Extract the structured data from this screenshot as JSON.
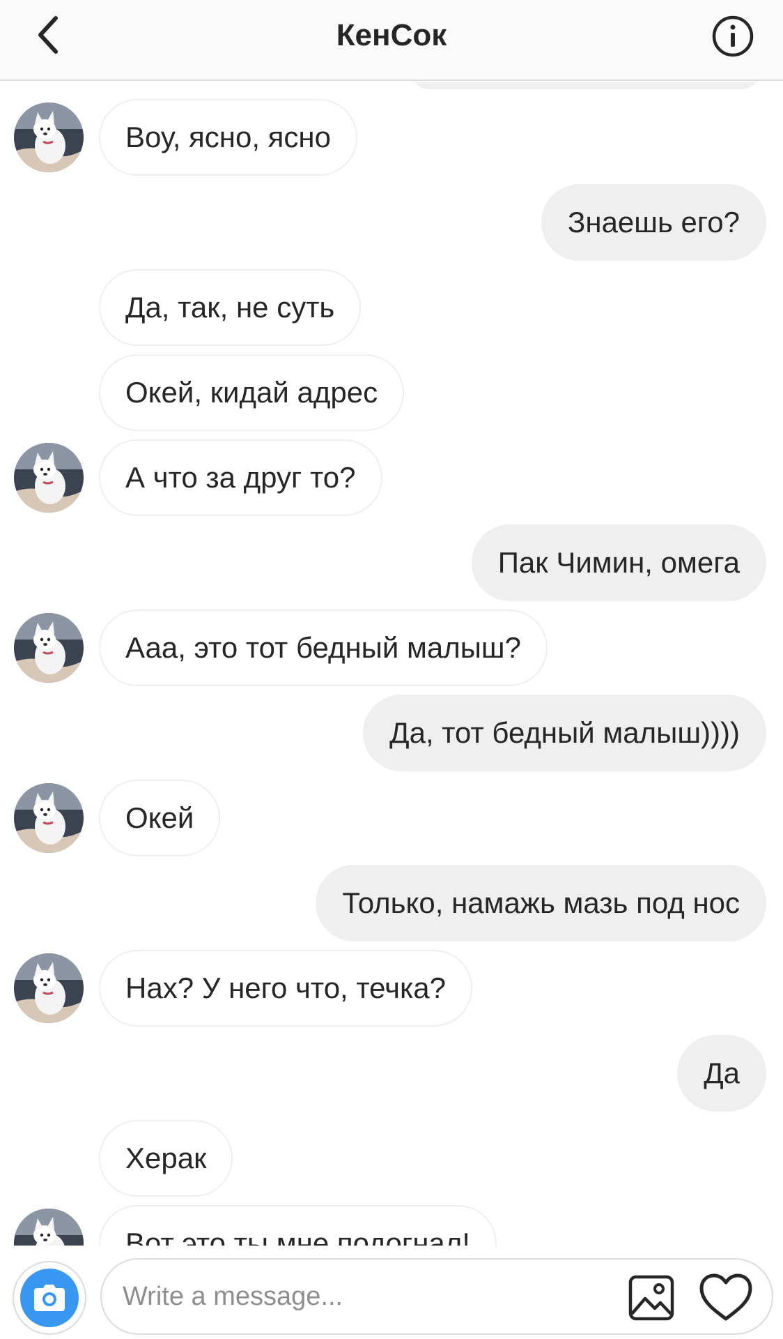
{
  "header": {
    "title": "КенСок",
    "back_icon": "chevron-left-icon",
    "info_icon": "info-circle-icon"
  },
  "messages": [
    {
      "side": "in",
      "text": "Воу, ясно, ясно",
      "avatar": true
    },
    {
      "side": "out",
      "text": "Знаешь его?"
    },
    {
      "side": "in",
      "text": "Да, так, не суть",
      "avatar": false
    },
    {
      "side": "in",
      "text": "Окей, кидай адрес",
      "avatar": false
    },
    {
      "side": "in",
      "text": "А что за друг то?",
      "avatar": true
    },
    {
      "side": "out",
      "text": "Пак Чимин, омега"
    },
    {
      "side": "in",
      "text": "Ааа, это тот бедный малыш?",
      "avatar": true
    },
    {
      "side": "out",
      "text": "Да, тот бедный малыш))))"
    },
    {
      "side": "in",
      "text": "Окей",
      "avatar": true
    },
    {
      "side": "out",
      "text": "Только, намажь мазь под нос"
    },
    {
      "side": "in",
      "text": "Нах? У него что, течка?",
      "avatar": true
    },
    {
      "side": "out",
      "text": "Да"
    },
    {
      "side": "in",
      "text": "Херак",
      "avatar": false
    },
    {
      "side": "in",
      "text": "Вот это ты мне подогнал!",
      "avatar": true
    }
  ],
  "composer": {
    "placeholder": "Write a message...",
    "camera_icon": "camera-icon",
    "gallery_icon": "image-gallery-icon",
    "heart_icon": "heart-icon"
  },
  "colors": {
    "accent": "#3897f0",
    "outgoing_bubble": "#efefef",
    "border": "#dbdbdb",
    "text": "#262626",
    "placeholder": "#8e8e8e"
  }
}
